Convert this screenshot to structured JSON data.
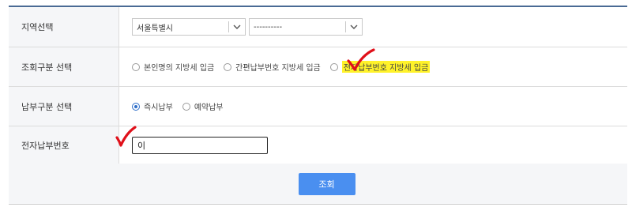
{
  "region_row": {
    "label": "지역선택",
    "select_city": "서울특별시",
    "select_district": "----------"
  },
  "query_type_row": {
    "label": "조회구분 선택",
    "options": [
      {
        "label": "본인명의 지방세 입금",
        "checked": false
      },
      {
        "label": "간편납부번호 지방세 입금",
        "checked": false
      },
      {
        "label": "전자납부번호 지방세 입금",
        "checked": false
      }
    ]
  },
  "payment_type_row": {
    "label": "납부구분 선택",
    "options": [
      {
        "label": "즉시납부",
        "checked": true
      },
      {
        "label": "예약납부",
        "checked": false
      }
    ]
  },
  "epay_number_row": {
    "label": "전자납부번호",
    "input_value": "이"
  },
  "actions": {
    "search_label": "조회"
  },
  "colors": {
    "header_border": "#4a6a94",
    "label_bg": "#f5f6f8",
    "button": "#4a8ff0",
    "highlight": "#fff22a",
    "annotation": "#e0101a"
  }
}
